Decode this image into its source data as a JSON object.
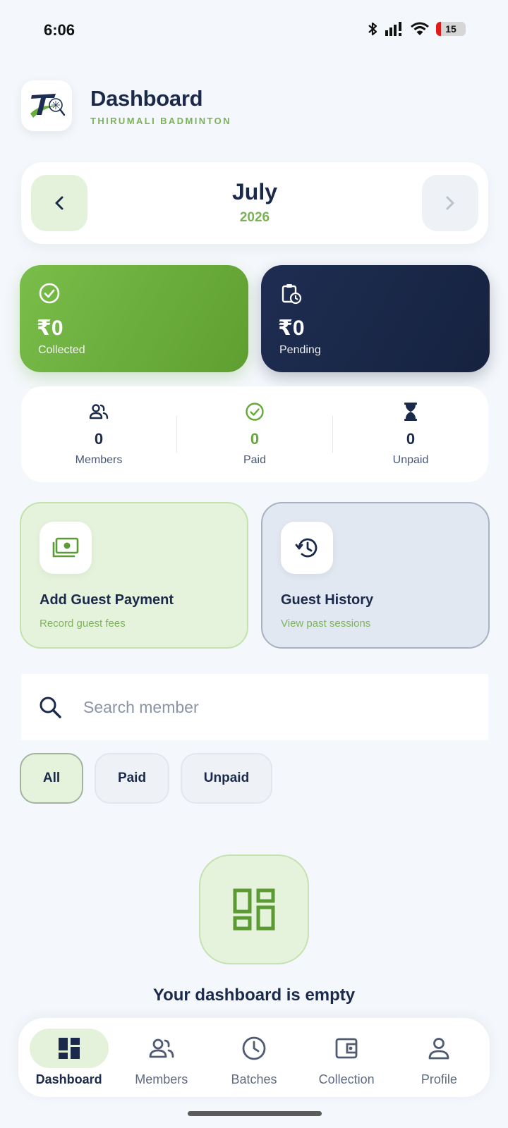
{
  "status_bar": {
    "time": "6:06",
    "battery": "15"
  },
  "header": {
    "title": "Dashboard",
    "subtitle": "THIRUMALI BADMINTON"
  },
  "month_selector": {
    "month": "July",
    "year": "2026"
  },
  "summary": {
    "collected": {
      "amount": "₹0",
      "label": "Collected"
    },
    "pending": {
      "amount": "₹0",
      "label": "Pending"
    }
  },
  "stats": [
    {
      "value": "0",
      "label": "Members"
    },
    {
      "value": "0",
      "label": "Paid"
    },
    {
      "value": "0",
      "label": "Unpaid"
    }
  ],
  "actions": {
    "guest_payment": {
      "title": "Add Guest Payment",
      "subtitle": "Record guest fees"
    },
    "guest_history": {
      "title": "Guest History",
      "subtitle": "View past sessions"
    }
  },
  "search": {
    "placeholder": "Search member",
    "value": ""
  },
  "filters": [
    "All",
    "Paid",
    "Unpaid"
  ],
  "selected_filter": "All",
  "empty_state": {
    "title": "Your dashboard is empty"
  },
  "bottom_nav": [
    {
      "label": "Dashboard",
      "icon": "dashboard-icon"
    },
    {
      "label": "Members",
      "icon": "members-icon"
    },
    {
      "label": "Batches",
      "icon": "clock-icon"
    },
    {
      "label": "Collection",
      "icon": "wallet-icon"
    },
    {
      "label": "Profile",
      "icon": "person-icon"
    }
  ],
  "colors": {
    "primary_navy": "#1b2a4a",
    "accent_green": "#66a83a",
    "light_green": "#e6f3dc",
    "background": "#f4f7fb"
  }
}
